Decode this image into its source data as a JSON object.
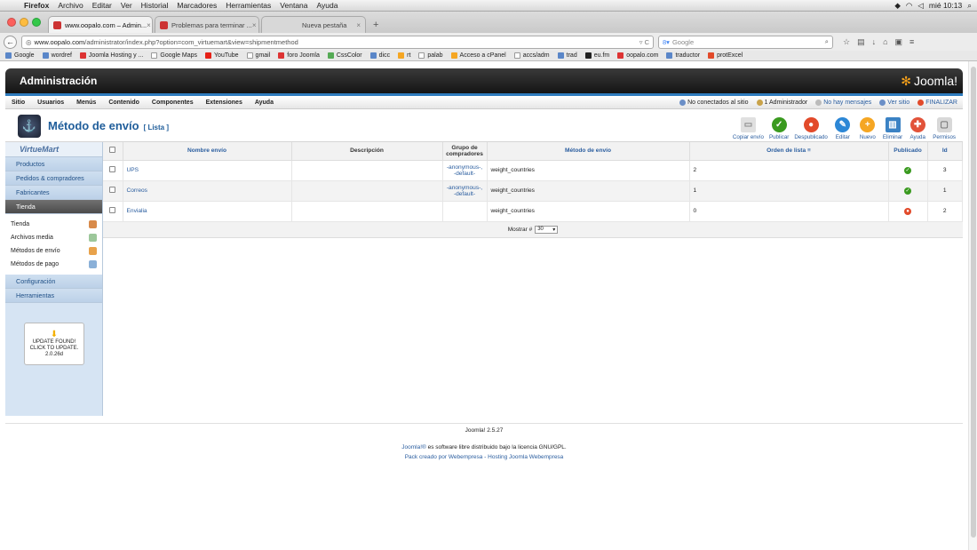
{
  "mac_menu": {
    "apple": "",
    "items": [
      "Firefox",
      "Archivo",
      "Editar",
      "Ver",
      "Historial",
      "Marcadores",
      "Herramientas",
      "Ventana",
      "Ayuda"
    ],
    "clock": "mié 10:13"
  },
  "tabs": [
    {
      "label": "www.oopalo.com – Admin...",
      "active": true
    },
    {
      "label": "Problemas para terminar ...",
      "active": false
    },
    {
      "label": "Nueva pestaña",
      "active": false
    }
  ],
  "nav": {
    "url_domain": "www.oopalo.com",
    "url_path": "/administrator/index.php?option=com_virtuemart&view=shipmentmethod",
    "search_placeholder": "Google"
  },
  "bookmarks": [
    "Google",
    "wordref",
    "Joomla Hosting y ...",
    "Google Maps",
    "YouTube",
    "gmail",
    "foro Joomla",
    "CssColor",
    "dicc",
    "rt",
    "palab",
    "Acceso a cPanel",
    "accs/adm",
    "trad",
    "eu.fm",
    "oopalo.com",
    "traductor",
    "protExcel"
  ],
  "header": {
    "title": "Administración",
    "logo_text": "Joomla!"
  },
  "menu": {
    "items": [
      "Sitio",
      "Usuarios",
      "Menús",
      "Contenido",
      "Componentes",
      "Extensiones",
      "Ayuda"
    ],
    "status": [
      "No conectados al sitio",
      "1 Administrador",
      "No hay mensajes",
      "Ver sitio",
      "FINALIZAR"
    ]
  },
  "toolbar": {
    "title": "Método de envío",
    "subtitle": "[ Lista ]",
    "buttons": [
      {
        "label": "Copiar envío",
        "color": "#e0e0e0",
        "glyph": "▭"
      },
      {
        "label": "Publicar",
        "color": "#3a9a1f",
        "glyph": "✓"
      },
      {
        "label": "Despublicado",
        "color": "#e24a2a",
        "glyph": "●"
      },
      {
        "label": "Editar",
        "color": "#2c87d6",
        "glyph": "✎"
      },
      {
        "label": "Nuevo",
        "color": "#f5a623",
        "glyph": "+"
      },
      {
        "label": "Eliminar",
        "color": "#3b82c4",
        "glyph": "🗑"
      },
      {
        "label": "Ayuda",
        "color": "#e2533a",
        "glyph": "✚"
      },
      {
        "label": "Permisos",
        "color": "#d8d8d8",
        "glyph": "🔒"
      }
    ]
  },
  "sidebar": {
    "brand": "VirtueMart",
    "items_top": [
      "Productos",
      "Pedidos & compradores",
      "Fabricantes",
      "Tienda"
    ],
    "sub_items": [
      "Tienda",
      "Archivos media",
      "Métodos de envío",
      "Métodos de pago"
    ],
    "items_bottom": [
      "Configuración",
      "Herramientas"
    ],
    "update": {
      "line1": "UPDATE FOUND!",
      "line2": "CLICK TO UPDATE.",
      "version": "2.0.26d"
    }
  },
  "table": {
    "headers": [
      "Nombre envío",
      "Descripción",
      "Grupo de compradores",
      "Método de envío",
      "Orden de lista",
      "Publicado",
      "Id"
    ],
    "rows": [
      {
        "name": "UPS",
        "desc": "",
        "group": "-anonymous-, -default-",
        "method": "weight_countries",
        "order": "2",
        "published": true,
        "id": "3"
      },
      {
        "name": "Correos",
        "desc": "",
        "group": "-anonymous-, -default-",
        "method": "weight_countries",
        "order": "1",
        "published": true,
        "id": "1"
      },
      {
        "name": "Envialia",
        "desc": "",
        "group": "",
        "method": "weight_countries",
        "order": "0",
        "published": false,
        "id": "2"
      }
    ],
    "show_label": "Mostrar #",
    "show_value": "30"
  },
  "footer": {
    "version": "Joomla! 2.5.27",
    "license_prefix": "Joomla!®",
    "license_text": "es software libre distribuido bajo la licencia GNU/GPL.",
    "pack": "Pack creado por Webempresa - Hosting Joomla Webempresa"
  },
  "colors": {
    "accent": "#2e7bbd",
    "link": "#2a5d9f",
    "published_on": "#3a9a1f",
    "published_off": "#e24a2a"
  }
}
